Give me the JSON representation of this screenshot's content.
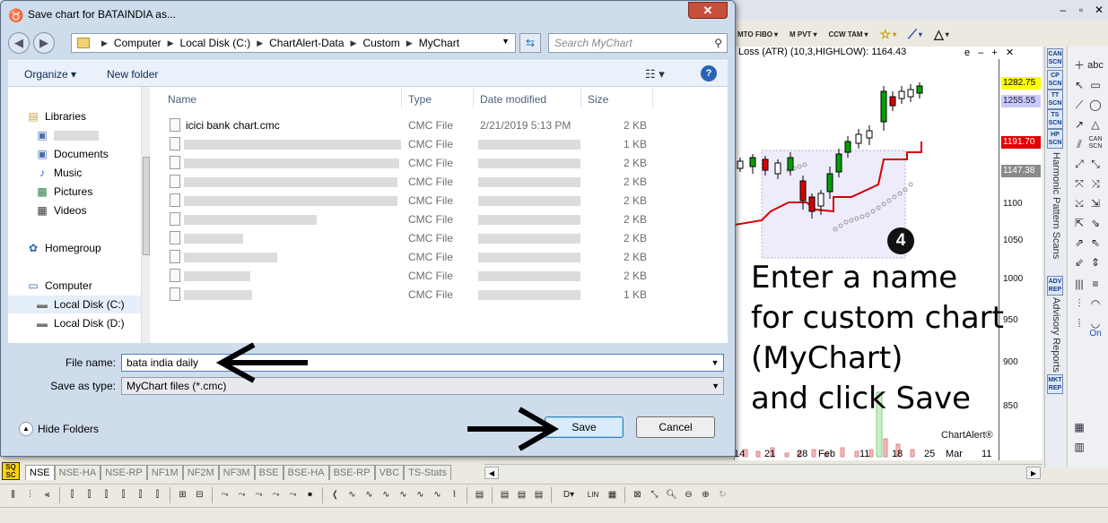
{
  "dialog": {
    "title": "Save chart for BATAINDIA as...",
    "close_label": "✕",
    "address": [
      "Computer",
      "Local Disk (C:)",
      "ChartAlert-Data",
      "Custom",
      "MyChart"
    ],
    "search_placeholder": "Search MyChart",
    "commands": {
      "organize": "Organize ▾",
      "new_folder": "New folder"
    },
    "nav": {
      "libraries": "Libraries",
      "documents": "Documents",
      "music": "Music",
      "pictures": "Pictures",
      "videos": "Videos",
      "homegroup": "Homegroup",
      "computer": "Computer",
      "local_c": "Local Disk (C:)",
      "local_d": "Local Disk (D:)"
    },
    "columns": {
      "name": "Name",
      "type": "Type",
      "date": "Date modified",
      "size": "Size"
    },
    "files": [
      {
        "name": "icici bank chart.cmc",
        "type": "CMC File",
        "date": "2/21/2019 5:13 PM",
        "size": "2 KB"
      },
      {
        "name": "",
        "type": "CMC File",
        "date": "",
        "size": "1 KB"
      },
      {
        "name": "",
        "type": "CMC File",
        "date": "",
        "size": "2 KB"
      },
      {
        "name": "",
        "type": "CMC File",
        "date": "",
        "size": "2 KB"
      },
      {
        "name": "",
        "type": "CMC File",
        "date": "",
        "size": "2 KB"
      },
      {
        "name": "",
        "type": "CMC File",
        "date": "",
        "size": "2 KB"
      },
      {
        "name": "",
        "type": "CMC File",
        "date": "",
        "size": "2 KB"
      },
      {
        "name": "",
        "type": "CMC File",
        "date": "",
        "size": "2 KB"
      },
      {
        "name": "",
        "type": "CMC File",
        "date": "",
        "size": "2 KB"
      },
      {
        "name": "",
        "type": "CMC File",
        "date": "",
        "size": "1 KB"
      }
    ],
    "file_name_label": "File name:",
    "file_name_value": "bata india daily",
    "save_type_label": "Save as type:",
    "save_type_value": "MyChart files (*.cmc)",
    "hide_folders": "Hide Folders",
    "save": "Save",
    "cancel": "Cancel"
  },
  "chart": {
    "header": "Loss (ATR) (10,3,HIGHLOW): 1164.43",
    "header_controls": "e – + ✕",
    "price_tags": [
      {
        "label": "1282.75",
        "bg": "#ffff00"
      },
      {
        "label": "1255.55",
        "bg": "#c9c9ff"
      },
      {
        "label": "1191.70",
        "bg": "#e00000"
      },
      {
        "label": "1147.38",
        "bg": "#8a8a8a"
      }
    ],
    "price_ticks": [
      "1100",
      "1050",
      "1000",
      "950",
      "900",
      "850"
    ],
    "date_ticks": [
      "14",
      "21",
      "28",
      "Feb",
      "11",
      "18",
      "25",
      "Mar",
      "11"
    ],
    "watermark": "ChartAlert®",
    "annotation_number": "4",
    "annotation_lines": [
      "Enter a name",
      "for custom chart",
      "(MyChart)",
      "and click Save"
    ]
  },
  "right_tools": {
    "scan_buttons": [
      "CAN SCN",
      "CP SCN",
      "TT SCN",
      "TS SCN",
      "HP SCN",
      "ADV REP",
      "MKT REP"
    ],
    "harmonic_label": "Harmonic Pattern Scans",
    "advisory_label": "Advisory Reports",
    "abc_label": "abc",
    "on_label": "On"
  },
  "exchange_tabs": [
    "NSE",
    "NSE-HA",
    "NSE-RP",
    "NF1M",
    "NF2M",
    "NF3M",
    "BSE",
    "BSE-HA",
    "BSE-RP",
    "VBC",
    "TS-Stats"
  ],
  "sq_label": "SQ\nSC",
  "toolbar_buttons": [
    "MTO FIBO",
    "M PVT",
    "CCW TAM",
    "☆",
    "⟋",
    "△"
  ],
  "app_window_controls": [
    "–",
    "▫",
    "✕"
  ],
  "colors": {
    "save_border": "#3c7fb1",
    "close_red": "#c7503b",
    "accent_blue": "#2a63b6"
  }
}
